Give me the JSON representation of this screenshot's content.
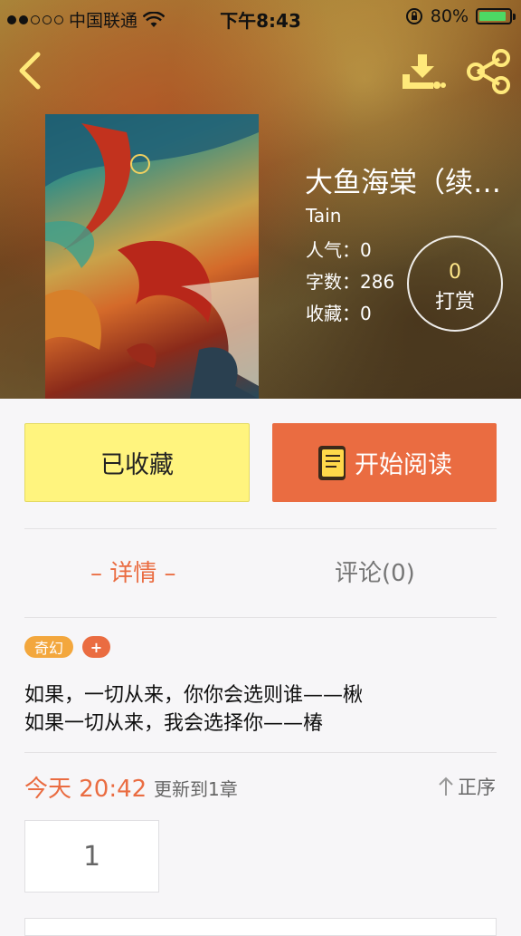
{
  "status_bar": {
    "carrier": "中国联通",
    "time": "下午8:43",
    "battery": "80%"
  },
  "book": {
    "title": "大鱼海棠（续…",
    "author": "Tain",
    "popularity": "人气：0",
    "word_count": "字数：286",
    "favorites": "收藏：0"
  },
  "reward": {
    "count": "0",
    "label": "打赏"
  },
  "actions": {
    "favorite_label": "已收藏",
    "read_label": "开始阅读"
  },
  "tabs": {
    "detail": "– 详情 –",
    "comments": "评论(0)"
  },
  "tags": {
    "genre": "奇幻",
    "add": "+"
  },
  "summary": {
    "line1": "如果，一切从来，你你会选则谁——楸",
    "line2": "如果一切从来，我会选择你——椿"
  },
  "update": {
    "time": "今天 20:42",
    "info": "更新到1章",
    "order_label": "正序"
  },
  "chapters": [
    "1"
  ],
  "colors": {
    "accent": "#ea6c41",
    "favorite_bg": "#fff47e",
    "tag_genre": "#f3a73d"
  },
  "icons": [
    "back-icon",
    "download-icon",
    "share-icon",
    "book-icon",
    "arrow-up-icon",
    "wifi-icon",
    "battery-icon",
    "lock-rotation-icon"
  ]
}
